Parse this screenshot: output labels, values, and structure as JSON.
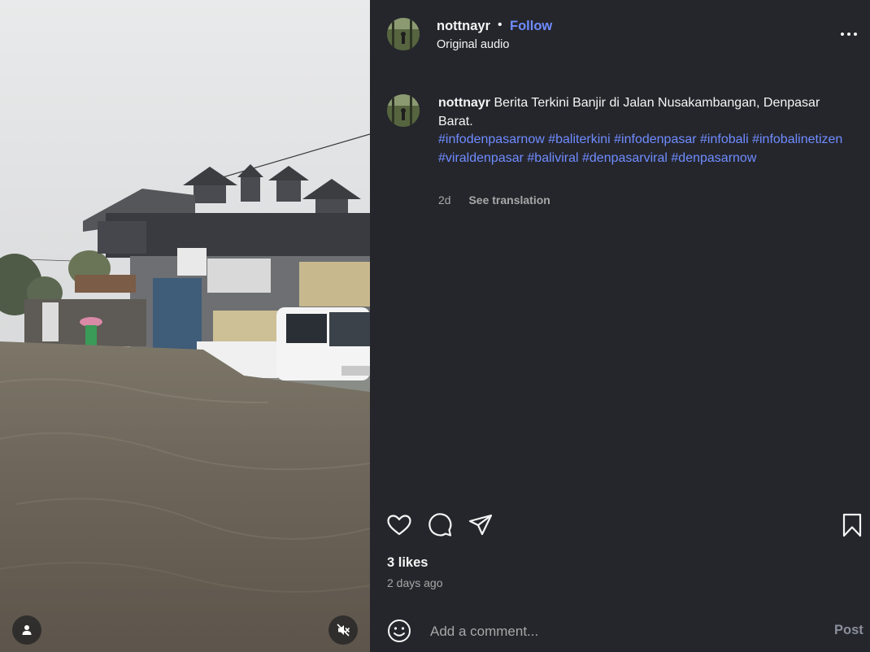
{
  "post": {
    "username": "nottnayr",
    "separator": "•",
    "follow_label": "Follow",
    "audio_label": "Original audio",
    "caption_username": "nottnayr",
    "caption_text": "Berita Terkini Banjir di Jalan Nusakambangan, Denpasar Barat.",
    "hashtags": [
      "#infodenpasarnow",
      "#baliterkini",
      "#infodenpasar",
      "#infobali",
      "#infobalinetizen",
      "#viraldenpasar",
      "#baliviral",
      "#denpasarviral",
      "#denpasarnow"
    ],
    "caption_age": "2d",
    "see_translation_label": "See translation",
    "likes_label": "3 likes",
    "time_ago": "2 days ago"
  },
  "comment_box": {
    "placeholder": "Add a comment...",
    "post_label": "Post"
  },
  "icons": {
    "more": "more-options-icon",
    "like": "heart-icon",
    "comment": "comment-icon",
    "share": "share-icon",
    "save": "bookmark-icon",
    "emoji": "emoji-icon",
    "tag": "user-tag-icon",
    "mute": "muted-speaker-icon"
  },
  "colors": {
    "panel_bg": "#25262c",
    "link_blue": "#6f8cff",
    "muted_text": "#a8a8a8"
  }
}
